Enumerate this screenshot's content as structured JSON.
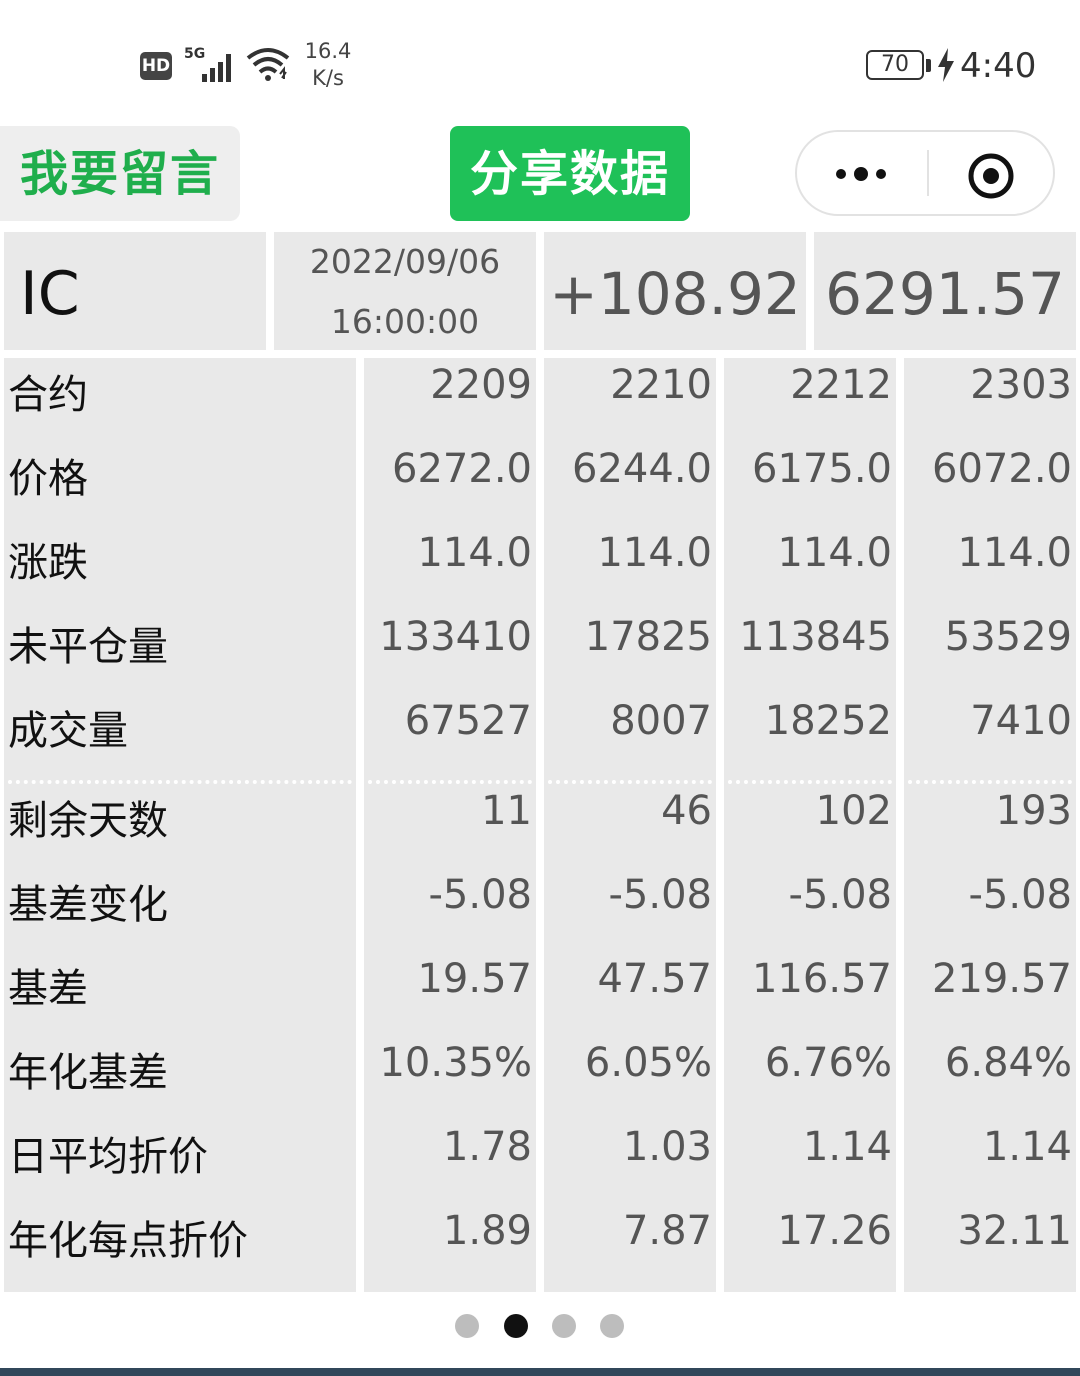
{
  "status": {
    "hd": "HD",
    "network": "5G",
    "speed_value": "16.4",
    "speed_unit": "K/s",
    "battery": "70",
    "time": "4:40"
  },
  "toolbar": {
    "message_label": "我要留言",
    "share_label": "分享数据",
    "more_icon": "more-dots-icon",
    "target_icon": "target-icon"
  },
  "header": {
    "code": "IC",
    "date": "2022/09/06",
    "time": "16:00:00",
    "change": "+108.92",
    "index_value": "6291.57"
  },
  "table": {
    "labels": [
      "合约",
      "价格",
      "涨跌",
      "未平仓量",
      "成交量",
      "剩余天数",
      "基差变化",
      "基差",
      "年化基差",
      "日平均折价",
      "年化每点折价"
    ],
    "columns": [
      [
        "2209",
        "6272.0",
        "114.0",
        "133410",
        "67527",
        "11",
        "-5.08",
        "19.57",
        "10.35%",
        "1.78",
        "1.89"
      ],
      [
        "2210",
        "6244.0",
        "114.0",
        "17825",
        "8007",
        "46",
        "-5.08",
        "47.57",
        "6.05%",
        "1.03",
        "7.87"
      ],
      [
        "2212",
        "6175.0",
        "114.0",
        "113845",
        "18252",
        "102",
        "-5.08",
        "116.57",
        "6.76%",
        "1.14",
        "17.26"
      ],
      [
        "2303",
        "6072.0",
        "114.0",
        "53529",
        "7410",
        "193",
        "-5.08",
        "219.57",
        "6.84%",
        "1.14",
        "32.11"
      ]
    ]
  },
  "pager": {
    "total": 4,
    "active_index": 1
  },
  "colors": {
    "accent_green": "#1fc158",
    "message_green": "#1fae4c",
    "cell_bg": "#e9e9e9"
  }
}
